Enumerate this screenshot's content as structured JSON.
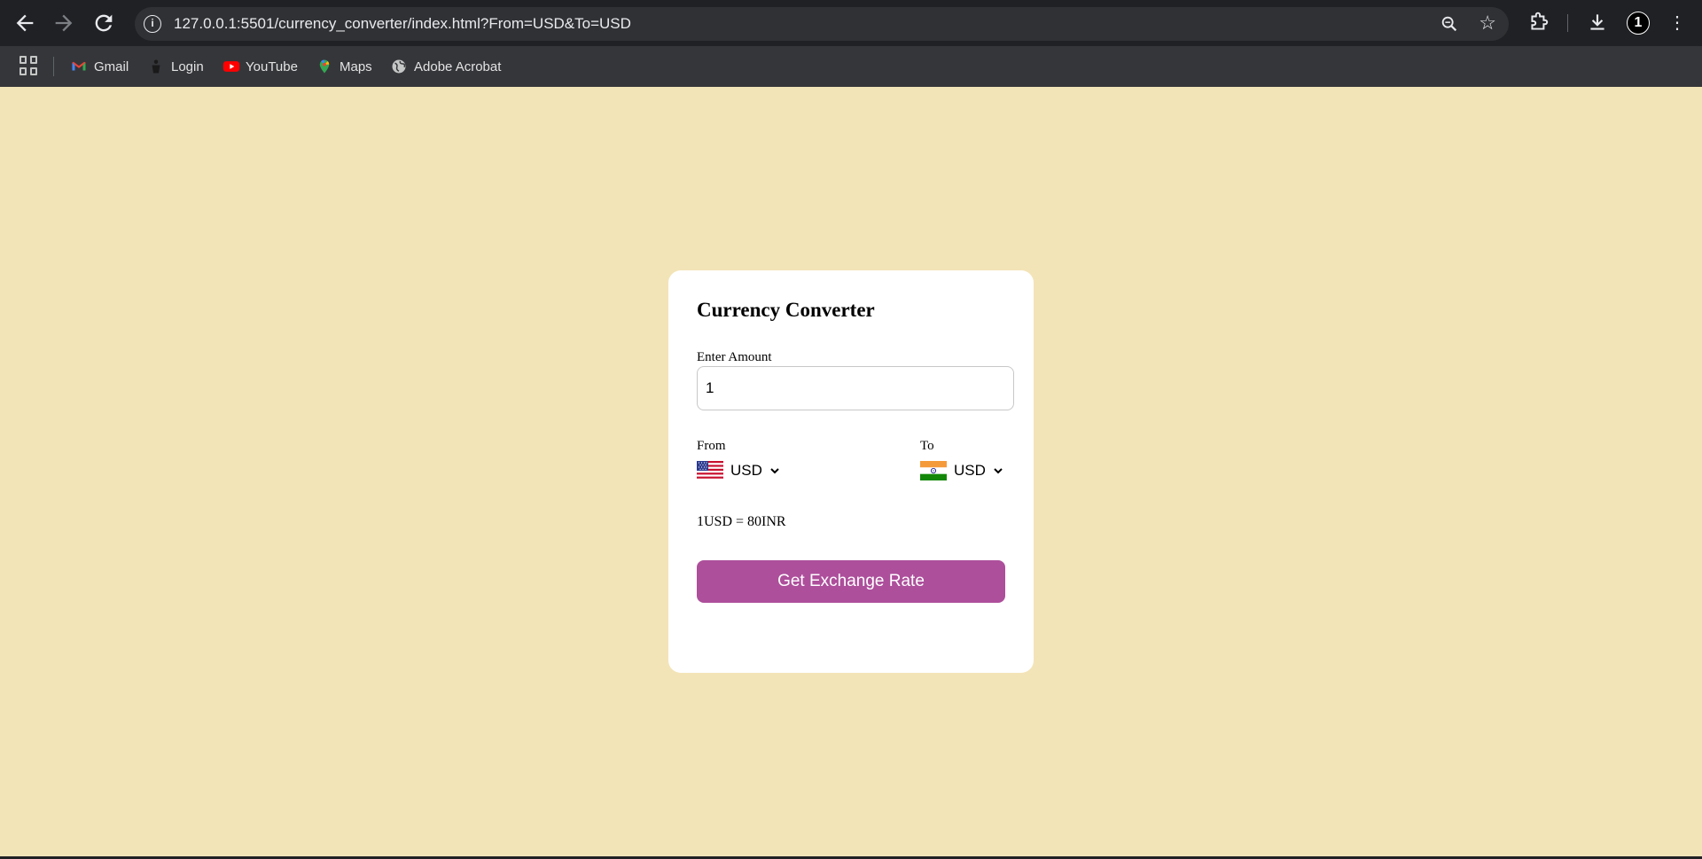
{
  "browser": {
    "url": "127.0.0.1:5501/currency_converter/index.html?From=USD&To=USD",
    "profile_initial": "1",
    "bookmarks": [
      {
        "label": "Gmail",
        "icon": "gmail-icon"
      },
      {
        "label": "Login",
        "icon": "login-icon"
      },
      {
        "label": "YouTube",
        "icon": "youtube-icon"
      },
      {
        "label": "Maps",
        "icon": "maps-icon"
      },
      {
        "label": "Adobe Acrobat",
        "icon": "globe-icon"
      }
    ]
  },
  "converter": {
    "title": "Currency Converter",
    "amount_label": "Enter Amount",
    "amount_value": "1",
    "from_label": "From",
    "from_currency": "USD",
    "from_flag": "us-flag-icon",
    "to_label": "To",
    "to_currency": "USD",
    "to_flag": "india-flag-icon",
    "rate_text": "1USD = 80INR",
    "button_label": "Get Exchange Rate"
  },
  "colors": {
    "page_background": "#f3e4b8",
    "card_background": "#ffffff",
    "button": "#ad4f9b"
  }
}
